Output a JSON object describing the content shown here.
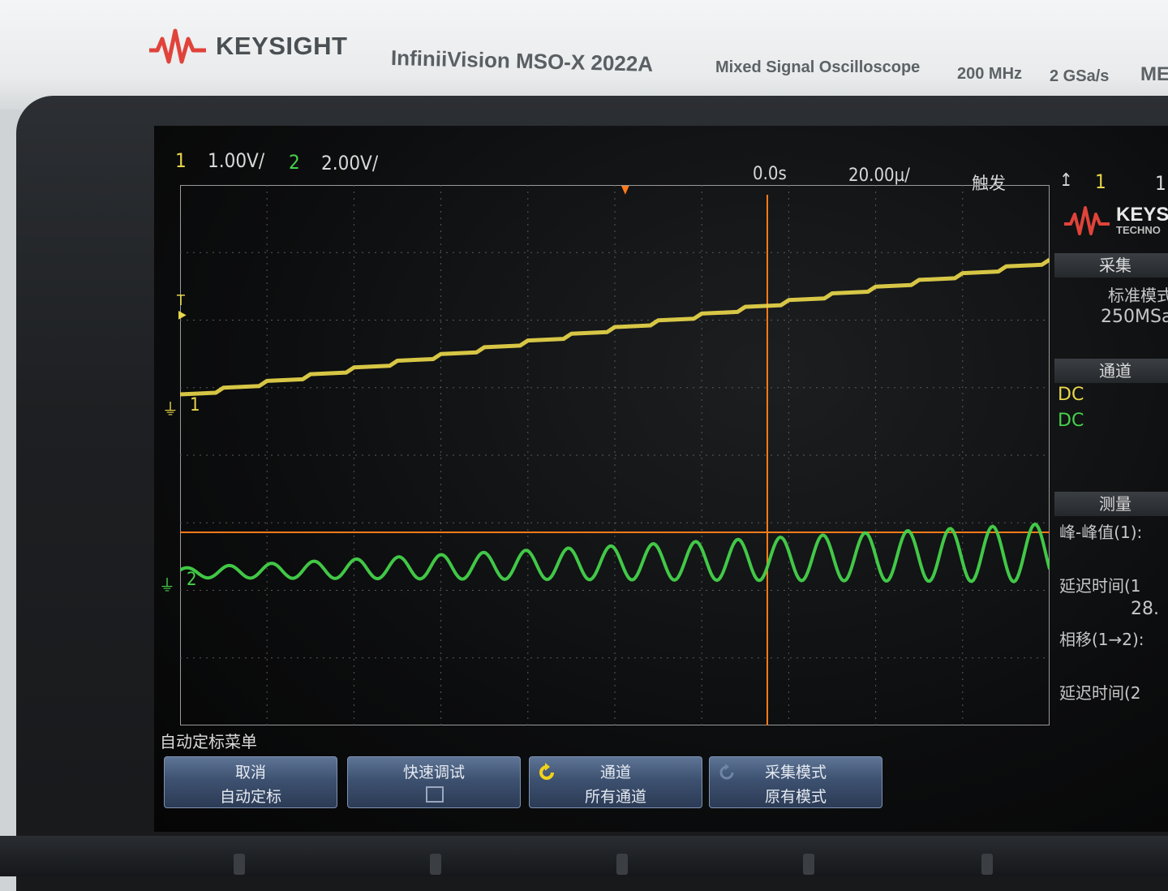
{
  "header": {
    "brand": "KEYSIGHT",
    "model": "InfiniiVision MSO-X 2022A",
    "description": "Mixed Signal Oscilloscope",
    "bandwidth": "200 MHz",
    "sample_rate": "2 GSa/s",
    "truncated": "ME"
  },
  "status": {
    "ch1_num": "1",
    "ch1_scale": "1.00V/",
    "ch2_num": "2",
    "ch2_scale": "2.00V/",
    "time_offset": "0.0s",
    "time_scale": "20.00µ/",
    "trigger_label": "触发",
    "trigger_source": "1",
    "trigger_level": "1"
  },
  "markers": {
    "trigger_marker": "T",
    "ch1_marker": "1",
    "ch2_marker": "2"
  },
  "side_panel": {
    "logo_brand": "KEYS",
    "logo_sub": "TECHNO",
    "acquire_head": "采集",
    "acquire_mode": "标准模式",
    "acquire_rate": "250MSa",
    "channel_head": "通道",
    "ch1_coupling": "DC",
    "ch2_coupling": "DC",
    "measure_head": "测量",
    "meas1_label": "峰-峰值(1):",
    "meas2_label": "延迟时间(1",
    "meas2_value": "28.",
    "meas3_label": "相移(1→2):",
    "meas4_label": "延迟时间(2"
  },
  "softmenu": {
    "title": "自动定标菜单",
    "key1_line1": "取消",
    "key1_line2": "自动定标",
    "key2_line1": "快速调试",
    "key3_line1": "通道",
    "key3_line2": "所有通道",
    "key4_line1": "采集模式",
    "key4_line2": "原有模式"
  },
  "colors": {
    "ch1": "#e8d64a",
    "ch2": "#45d24a",
    "cursor": "#ff7a1a",
    "grid": "#5a5a5a"
  },
  "chart_data": {
    "type": "line",
    "series": [
      {
        "name": "1",
        "description_values": "staircase ramp",
        "values": []
      },
      {
        "name": "2",
        "description_values": "sine with increasing amplitude",
        "values": []
      }
    ]
  }
}
